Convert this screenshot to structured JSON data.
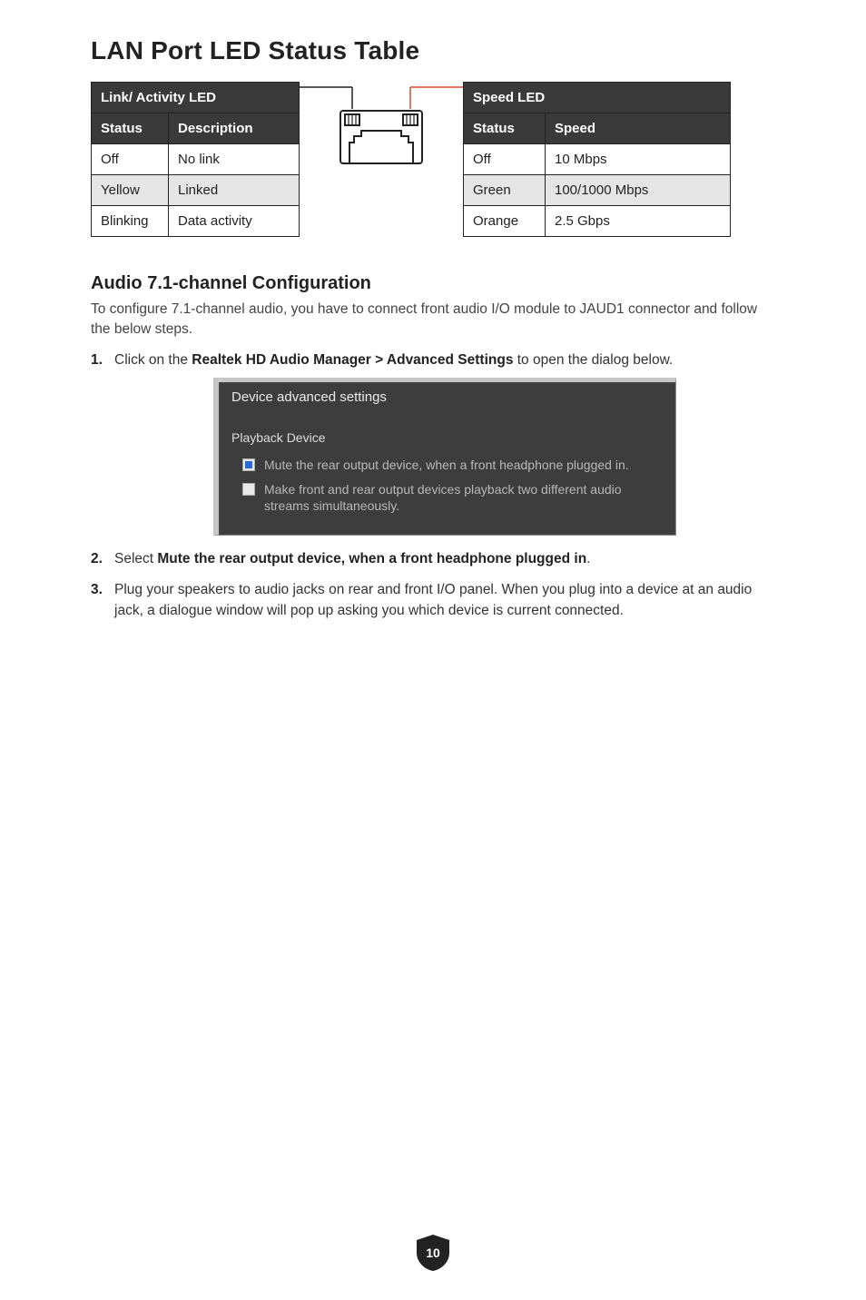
{
  "heading1": "LAN Port LED Status Table",
  "link_table": {
    "title": "Link/ Activity LED",
    "headers": [
      "Status",
      "Description"
    ],
    "rows": [
      {
        "c0": "Off",
        "c1": "No link",
        "alt": false
      },
      {
        "c0": "Yellow",
        "c1": "Linked",
        "alt": true
      },
      {
        "c0": "Blinking",
        "c1": "Data activity",
        "alt": false
      }
    ]
  },
  "speed_table": {
    "title": "Speed LED",
    "headers": [
      "Status",
      "Speed"
    ],
    "rows": [
      {
        "c0": "Off",
        "c1": "10 Mbps",
        "alt": false
      },
      {
        "c0": "Green",
        "c1": "100/1000 Mbps",
        "alt": true
      },
      {
        "c0": "Orange",
        "c1": "2.5 Gbps",
        "alt": false
      }
    ]
  },
  "heading2": "Audio 7.1-channel Configuration",
  "intro": "To configure 7.1-channel audio, you have to connect front audio I/O module to JAUD1 connector and follow the below steps.",
  "step1_pre": "Click on the ",
  "step1_bold": "Realtek HD Audio Manager > Advanced Settings",
  "step1_post": " to open the dialog below.",
  "dialog": {
    "title": "Device advanced settings",
    "section": "Playback Device",
    "opt1": "Mute the rear output device, when a front headphone plugged in.",
    "opt2": "Make front and rear output devices playback two different audio streams simultaneously."
  },
  "step2_pre": "Select ",
  "step2_bold": "Mute the rear output device, when a front headphone plugged in",
  "step2_post": ".",
  "step3": "Plug your speakers to audio jacks on rear and front I/O panel. When you plug into a device at an audio jack, a dialogue window will pop up asking you which device is current connected.",
  "page_number": "10"
}
